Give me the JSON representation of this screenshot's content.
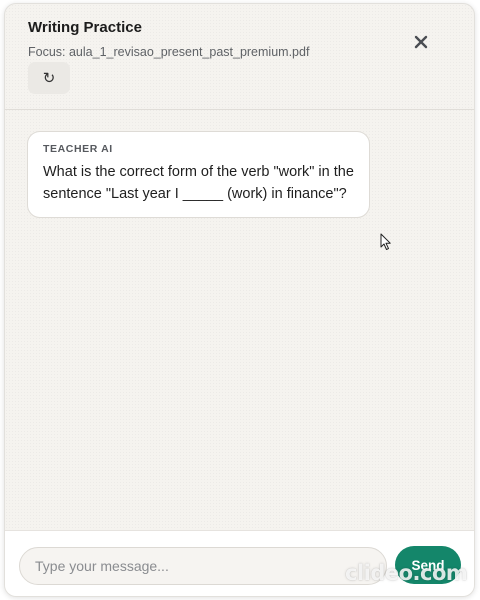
{
  "header": {
    "title": "Writing Practice",
    "focus": "Focus: aula_1_revisao_present_past_premium.pdf",
    "close_icon": "close-icon",
    "refresh_icon": "refresh-icon",
    "refresh_glyph": "↻"
  },
  "messages": [
    {
      "sender": "TEACHER AI",
      "text": "What is the correct form of the verb \"work\" in the sentence \"Last year I _____ (work) in finance\"?"
    }
  ],
  "composer": {
    "placeholder": "Type your message...",
    "value": "",
    "send_label": "Send"
  },
  "watermark": "clideo.com",
  "colors": {
    "accent": "#14866a",
    "background": "#f5f3ef",
    "bubble": "#ffffff"
  }
}
